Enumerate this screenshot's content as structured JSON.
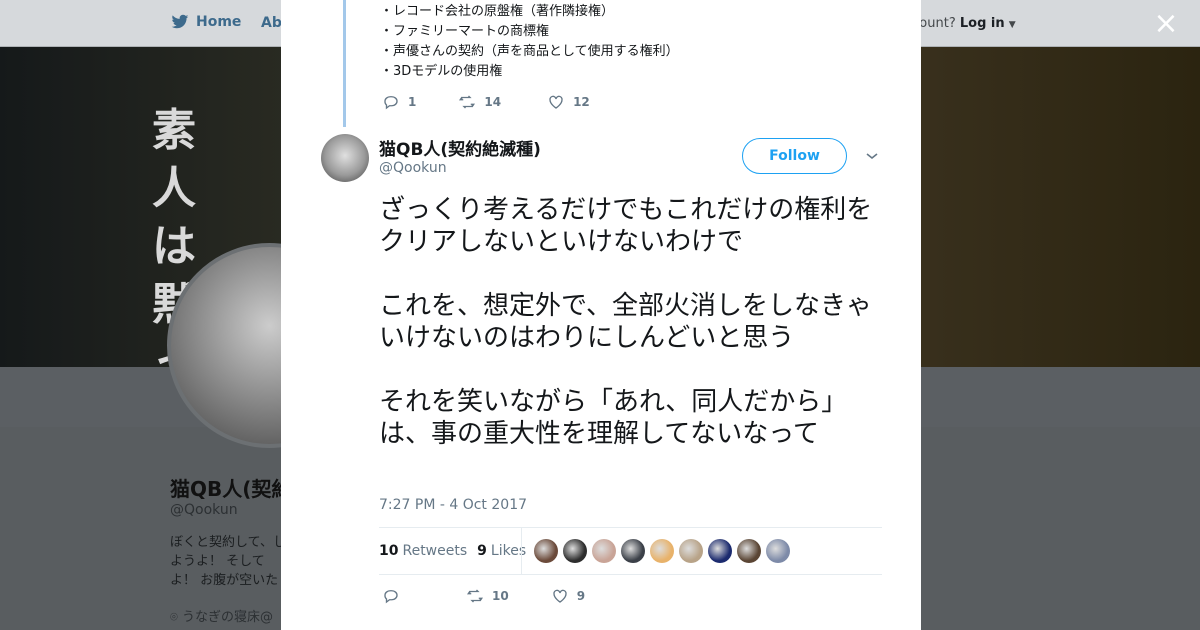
{
  "background": {
    "nav": {
      "home": "Home",
      "about": "Abo",
      "login_prefix": "ccount?",
      "login": "Log in"
    },
    "banner_text": "素人は黙っと",
    "profile": {
      "name": "猫QB人(契約",
      "handle": "@Qookun",
      "bio": "ぼくと契約して、しようよ！ そしてよ！ お腹が空いた",
      "location": "うなぎの寝床@"
    }
  },
  "modal": {
    "close_label": "×",
    "previous_tweet": {
      "lines": [
        "・レコード会社の原盤権（著作隣接権）",
        "・ファミリーマートの商標権",
        "・声優さんの契約（声を商品として使用する権利）",
        "・3Dモデルの使用権"
      ],
      "replies": "1",
      "retweets": "14",
      "likes": "12"
    },
    "tweet": {
      "name": "猫QB人(契約絶滅種)",
      "handle": "@Qookun",
      "follow_label": "Follow",
      "paragraphs": [
        "ざっくり考えるだけでもこれだけの権利をクリアしないといけないわけで",
        "これを、想定外で、全部火消しをしなきゃいけないのはわりにしんどいと思う",
        "それを笑いながら「あれ、同人だから」は、事の重大性を理解してないなって"
      ],
      "timestamp": "7:27 PM - 4 Oct 2017",
      "retweets_count": "10",
      "retweets_label": "Retweets",
      "likes_count": "9",
      "likes_label": "Likes",
      "reply_count": "",
      "retweet_action_count": "10",
      "like_action_count": "9"
    },
    "liker_colors": [
      "#6b4a3a",
      "#2d2d2d",
      "#c9a497",
      "#3b4048",
      "#e8b26a",
      "#b8a388",
      "#1b2a6e",
      "#5a4534",
      "#7d8aa8"
    ]
  },
  "colors": {
    "accent": "#1da1f2",
    "text": "#14171a",
    "muted": "#657786",
    "thread": "#a3c8ea"
  }
}
